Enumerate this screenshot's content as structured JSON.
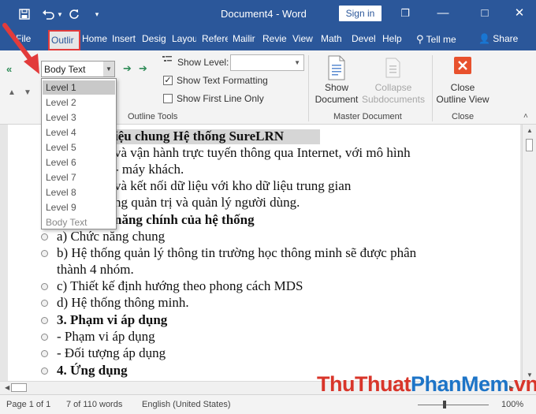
{
  "window": {
    "doc_title": "Document4 - Word",
    "signin_label": "Sign in",
    "restore_symbol": "❐",
    "minimize_symbol": "—",
    "maximize_symbol": "□",
    "close_symbol": "✕"
  },
  "tabs": [
    {
      "label": "File",
      "active": false
    },
    {
      "label": "Outlir",
      "active": true
    },
    {
      "label": "Home",
      "active": false
    },
    {
      "label": "Insert",
      "active": false
    },
    {
      "label": "Desig",
      "active": false
    },
    {
      "label": "Layou",
      "active": false
    },
    {
      "label": "Refere",
      "active": false
    },
    {
      "label": "Mailir",
      "active": false
    },
    {
      "label": "Revie",
      "active": false
    },
    {
      "label": "View",
      "active": false
    },
    {
      "label": "Math",
      "active": false
    },
    {
      "label": "Devel",
      "active": false
    },
    {
      "label": "Help",
      "active": false
    }
  ],
  "tellme_label": "Tell me",
  "share_label": "Share",
  "outline_tools": {
    "level_value": "Body Text",
    "show_level_label": "Show Level:",
    "show_level_value": "",
    "show_text_formatting_label": "Show Text Formatting",
    "show_text_formatting_checked": true,
    "show_first_line_only_label": "Show First Line Only",
    "show_first_line_only_checked": false,
    "group_label": "Outline Tools"
  },
  "master_document": {
    "show_document_label": [
      "Show",
      "Document"
    ],
    "collapse_subdocuments_label": [
      "Collapse",
      "Subdocuments"
    ],
    "group_label": "Master Document"
  },
  "close_group": {
    "close_outline_label": [
      "Close",
      "Outline View"
    ],
    "group_label": "Close"
  },
  "level_dropdown": {
    "items": [
      "Level 1",
      "Level 2",
      "Level 3",
      "Level 4",
      "Level 5",
      "Level 6",
      "Level 7",
      "Level 8",
      "Level 9",
      "Body Text"
    ],
    "selected": "Level 1"
  },
  "document": {
    "lines": [
      {
        "text": "iệu chung Hệ thống SureLRN",
        "bold": true,
        "bullet": false
      },
      {
        "text": "và vận hành trực tuyến thông qua Internet, với mô hình",
        "bold": false,
        "bullet": false
      },
      {
        "text": "- máy khách.",
        "bold": false,
        "bullet": false
      },
      {
        "text": "và kết nối dữ liệu với kho dữ liệu trung gian",
        "bold": false,
        "bullet": false
      },
      {
        "text": "ng quản trị và quản lý người dùng.",
        "bold": false,
        "bullet": false
      },
      {
        "text": "năng chính của hệ thống",
        "bold": true,
        "bullet": false
      },
      {
        "text": "a) Chức năng chung",
        "bold": false,
        "bullet": true
      },
      {
        "text": "b) Hệ thống quản lý thông tin trường học thông minh sẽ được phân",
        "bold": false,
        "bullet": true
      },
      {
        "text": "thành 4 nhóm.",
        "bold": false,
        "bullet": false
      },
      {
        "text": "c) Thiết kế định hướng theo phong cách MDS",
        "bold": false,
        "bullet": true
      },
      {
        "text": "d) Hệ thống thông minh.",
        "bold": false,
        "bullet": true
      },
      {
        "text": "3. Phạm vi áp dụng",
        "bold": true,
        "bullet": true
      },
      {
        "text": "- Phạm vi áp dụng",
        "bold": false,
        "bullet": true
      },
      {
        "text": "- Đối tượng áp dụng",
        "bold": false,
        "bullet": true
      },
      {
        "text": "4. Ứng dụng",
        "bold": true,
        "bullet": true
      }
    ]
  },
  "statusbar": {
    "page": "Page 1 of 1",
    "words": "7 of 110 words",
    "language": "English (United States)",
    "zoom": "100%"
  },
  "watermark": {
    "part1": "ThuThuat",
    "part2": "PhanMem",
    "part3": ".vn"
  },
  "colors": {
    "titlebar": "#2b579a",
    "highlight_border": "#e23b3b",
    "close_icon": "#e8512d",
    "watermark_red": "#d8352a",
    "watermark_blue": "#1d74c7"
  }
}
